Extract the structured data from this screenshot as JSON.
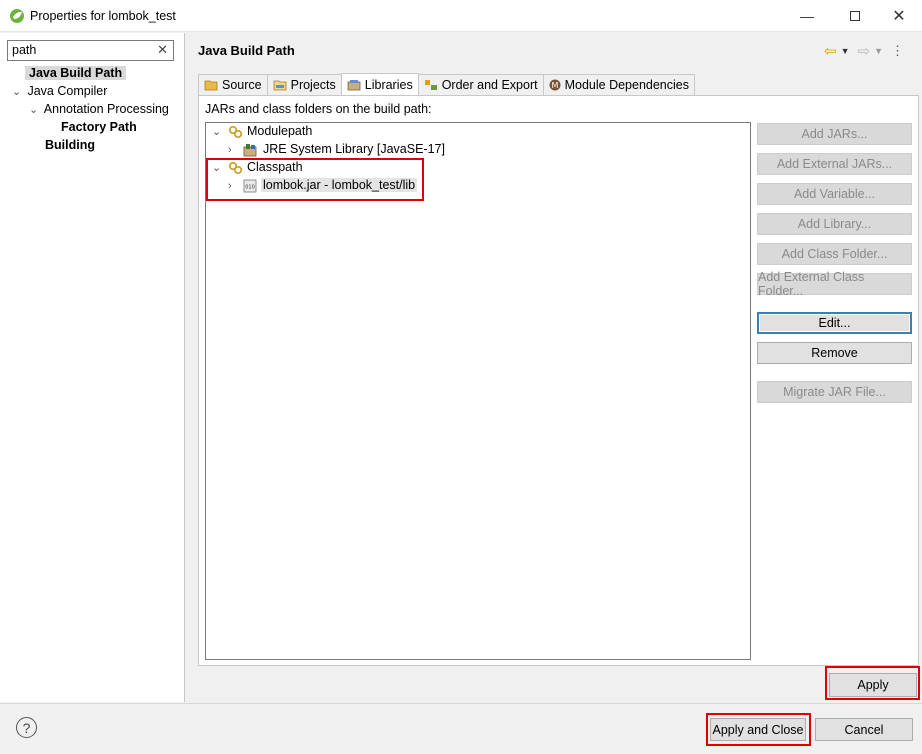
{
  "window": {
    "title": "Properties for lombok_test"
  },
  "search": {
    "value": "path"
  },
  "sidebar": {
    "items": [
      {
        "label": "Java Build Path"
      },
      {
        "label": "Java Compiler"
      },
      {
        "label": "Annotation Processing"
      },
      {
        "label": "Factory Path"
      },
      {
        "label": "Building"
      }
    ]
  },
  "page": {
    "title": "Java Build Path"
  },
  "tabs": [
    {
      "label": "Source"
    },
    {
      "label": "Projects"
    },
    {
      "label": "Libraries"
    },
    {
      "label": "Order and Export"
    },
    {
      "label": "Module Dependencies"
    }
  ],
  "libraries": {
    "caption": "JARs and class folders on the build path:",
    "tree": [
      {
        "label": "Modulepath"
      },
      {
        "label": "JRE System Library [JavaSE-17]"
      },
      {
        "label": "Classpath"
      },
      {
        "label": "lombok.jar - lombok_test/lib"
      }
    ]
  },
  "buttons": {
    "add_jars": "Add JARs...",
    "add_external_jars": "Add External JARs...",
    "add_variable": "Add Variable...",
    "add_library": "Add Library...",
    "add_class_folder": "Add Class Folder...",
    "add_external_class_folder": "Add External Class Folder...",
    "edit": "Edit...",
    "remove": "Remove",
    "migrate_jar": "Migrate JAR File...",
    "apply": "Apply",
    "apply_close": "Apply and Close",
    "cancel": "Cancel"
  },
  "colors": {
    "highlight": "#e00000",
    "accent": "#3c7fb1"
  }
}
